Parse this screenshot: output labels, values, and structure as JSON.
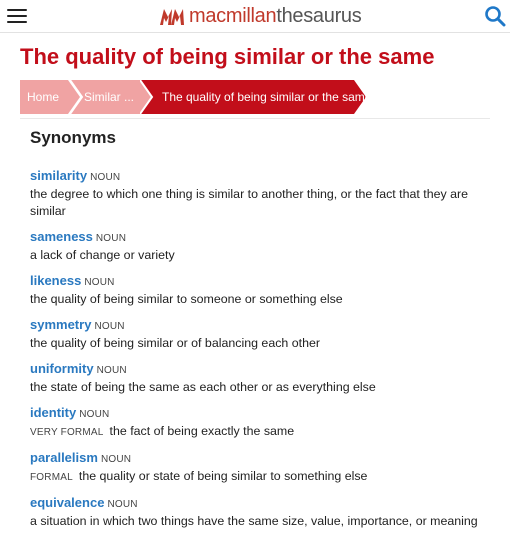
{
  "header": {
    "logo_word1": "macmillan",
    "logo_word2": "thesaurus",
    "brand_color": "#c0392b"
  },
  "page": {
    "title": "The quality of being similar or the same"
  },
  "breadcrumb": {
    "items": [
      {
        "label": "Home",
        "color": "#f0a3a3"
      },
      {
        "label": "Similar ...",
        "color": "#f0a3a3"
      },
      {
        "label": "The quality of being similar or the same",
        "color": "#c20e1a"
      }
    ]
  },
  "synonyms": {
    "heading": "Synonyms",
    "entries": [
      {
        "word": "similarity",
        "pos": "NOUN",
        "register": "",
        "definition": "the degree to which one thing is similar to another thing, or the fact that they are similar"
      },
      {
        "word": "sameness",
        "pos": "NOUN",
        "register": "",
        "definition": "a lack of change or variety"
      },
      {
        "word": "likeness",
        "pos": "NOUN",
        "register": "",
        "definition": "the quality of being similar to someone or something else"
      },
      {
        "word": "symmetry",
        "pos": "NOUN",
        "register": "",
        "definition": "the quality of being similar or of balancing each other"
      },
      {
        "word": "uniformity",
        "pos": "NOUN",
        "register": "",
        "definition": "the state of being the same as each other or as everything else"
      },
      {
        "word": "identity",
        "pos": "NOUN",
        "register": "VERY FORMAL",
        "definition": "the fact of being exactly the same"
      },
      {
        "word": "parallelism",
        "pos": "NOUN",
        "register": "FORMAL",
        "definition": "the quality or state of being similar to something else"
      },
      {
        "word": "equivalence",
        "pos": "NOUN",
        "register": "",
        "definition": "a situation in which two things have the same size, value, importance, or meaning"
      }
    ]
  },
  "icons": {
    "menu": "hamburger-menu-icon",
    "search": "search-icon",
    "logo": "macmillan-logo-icon"
  }
}
